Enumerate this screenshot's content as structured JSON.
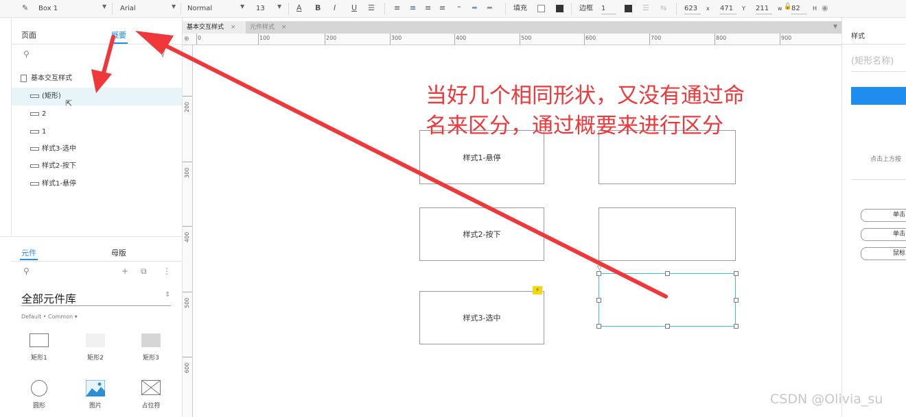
{
  "toolbar": {
    "widget_name": "Box 1",
    "font": "Arial",
    "style": "Normal",
    "size": "13",
    "fill_label": "填充",
    "border_label": "边框",
    "border_value": "1",
    "x": "623",
    "x_label": "x",
    "y": "471",
    "y_label": "Y",
    "w": "211",
    "w_label": "w",
    "h": "82",
    "h_label": "H"
  },
  "left_tabs": {
    "pages": "页面",
    "outline": "概要"
  },
  "outline": {
    "items": [
      {
        "label": "基本交互样式",
        "type": "page"
      },
      {
        "label": "(矩形)",
        "type": "rect",
        "highlight": true
      },
      {
        "label": "2",
        "type": "rect"
      },
      {
        "label": "1",
        "type": "rect"
      },
      {
        "label": "样式3-选中",
        "type": "rect"
      },
      {
        "label": "样式2-按下",
        "type": "rect"
      },
      {
        "label": "样式1-悬停",
        "type": "rect"
      }
    ]
  },
  "library_tabs": {
    "widgets": "元件",
    "masters": "母版"
  },
  "library": {
    "title": "全部元件库",
    "subtitle": "Default • Common ▾",
    "widgets": [
      {
        "label": "矩形1",
        "shape": "rect-outline"
      },
      {
        "label": "矩形2",
        "shape": "rect-light"
      },
      {
        "label": "矩形3",
        "shape": "rect-gray"
      },
      {
        "label": "圆形",
        "shape": "circle"
      },
      {
        "label": "图片",
        "shape": "image-icon"
      },
      {
        "label": "占位符",
        "shape": "placeholder-icon"
      }
    ]
  },
  "doc_tabs": [
    {
      "label": "基本交互样式",
      "active": true
    },
    {
      "label": "元件样式",
      "active": false
    }
  ],
  "ruler": {
    "h_labels": [
      "0",
      "100",
      "200",
      "300",
      "400",
      "500",
      "600",
      "700",
      "800",
      "900"
    ],
    "v_labels": [
      "200",
      "300",
      "400",
      "500",
      "600"
    ]
  },
  "canvas": {
    "boxes": [
      {
        "label": "样式1-悬停"
      },
      {
        "label": ""
      },
      {
        "label": "样式2-按下"
      },
      {
        "label": ""
      },
      {
        "label": "样式3-选中"
      },
      {
        "label": ""
      }
    ],
    "flag_icon": "lightning-icon"
  },
  "annotation": {
    "line1": "当好几个相同形状，又没有通过命",
    "line2": "名来区分，通过概要来进行区分",
    "color": "#f0373a"
  },
  "right_panel": {
    "title": "样式",
    "name_placeholder": "(矩形名称)",
    "hint": "点击上方按",
    "pills": [
      "单击",
      "单击",
      "鼠标"
    ],
    "accent": "#1f8ded"
  },
  "watermark": "CSDN @Olivia_su"
}
